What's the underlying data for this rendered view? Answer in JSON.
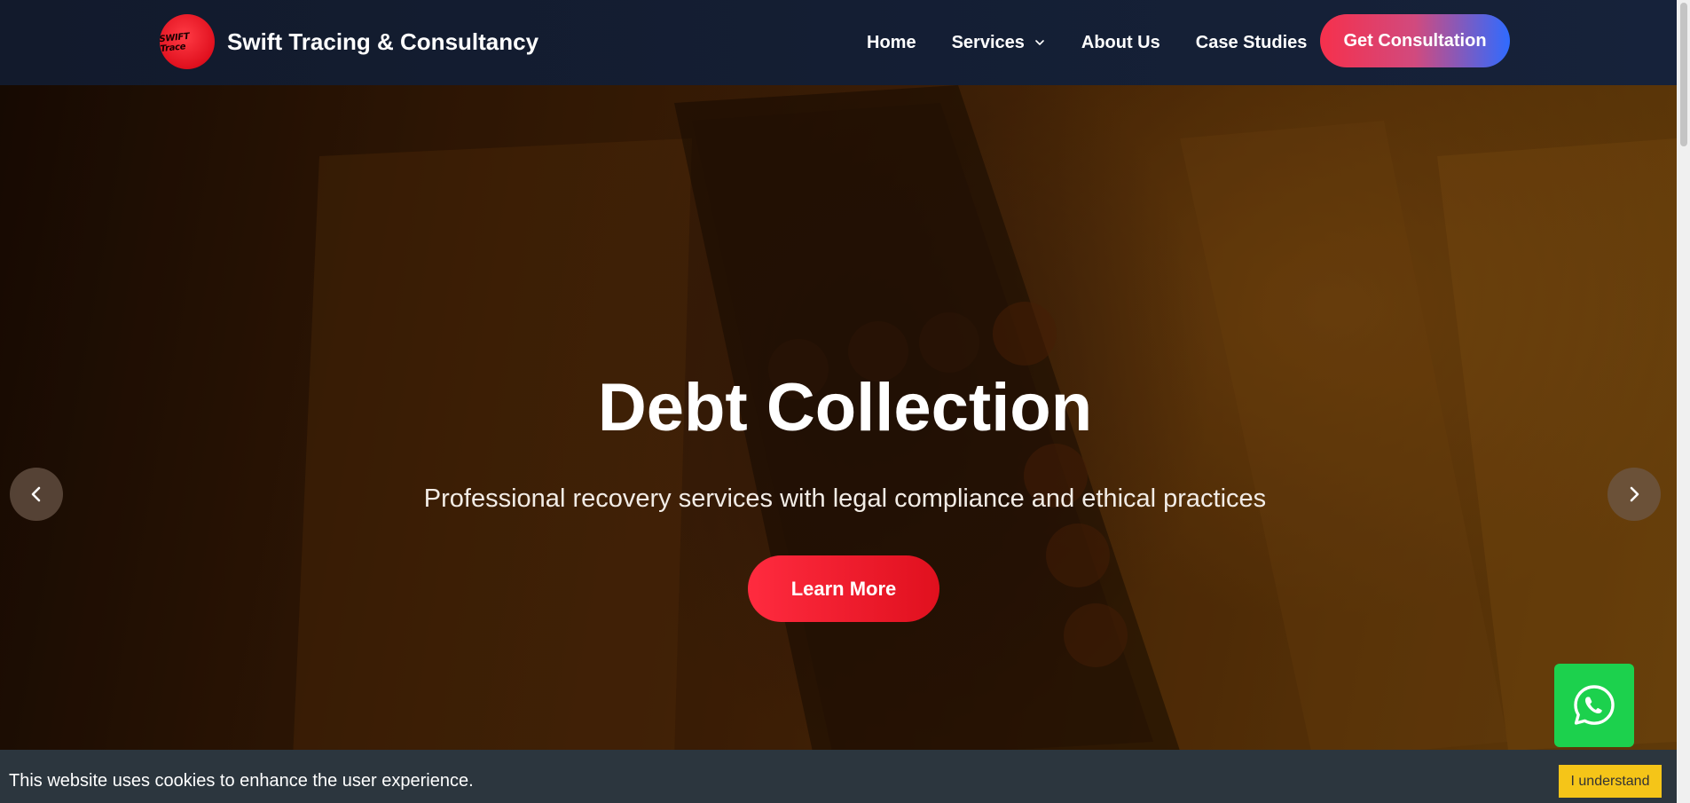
{
  "header": {
    "logo_text": "SWIFT Trace",
    "brand_name": "Swift Tracing & Consultancy",
    "nav": [
      {
        "label": "Home"
      },
      {
        "label": "Services",
        "has_dropdown": true
      },
      {
        "label": "About Us"
      },
      {
        "label": "Case Studies"
      }
    ],
    "cta_label": "Get Consultation"
  },
  "hero": {
    "title": "Debt Collection",
    "subtitle": "Professional recovery services with legal compliance and ethical practices",
    "button_label": "Learn More",
    "prev_icon": "chevron-left-icon",
    "next_icon": "chevron-right-icon"
  },
  "whatsapp": {
    "icon": "whatsapp-icon"
  },
  "cookie_banner": {
    "message": "This website uses cookies to enhance the user experience.",
    "button_label": "I understand"
  },
  "colors": {
    "header_bg": "#121a2c",
    "brand_red": "#e0101e",
    "cta_gradient_end": "#2f6bff",
    "whatsapp_green": "#1cd14d",
    "cookie_bg": "#2c363e",
    "cookie_button": "#f5c518"
  }
}
